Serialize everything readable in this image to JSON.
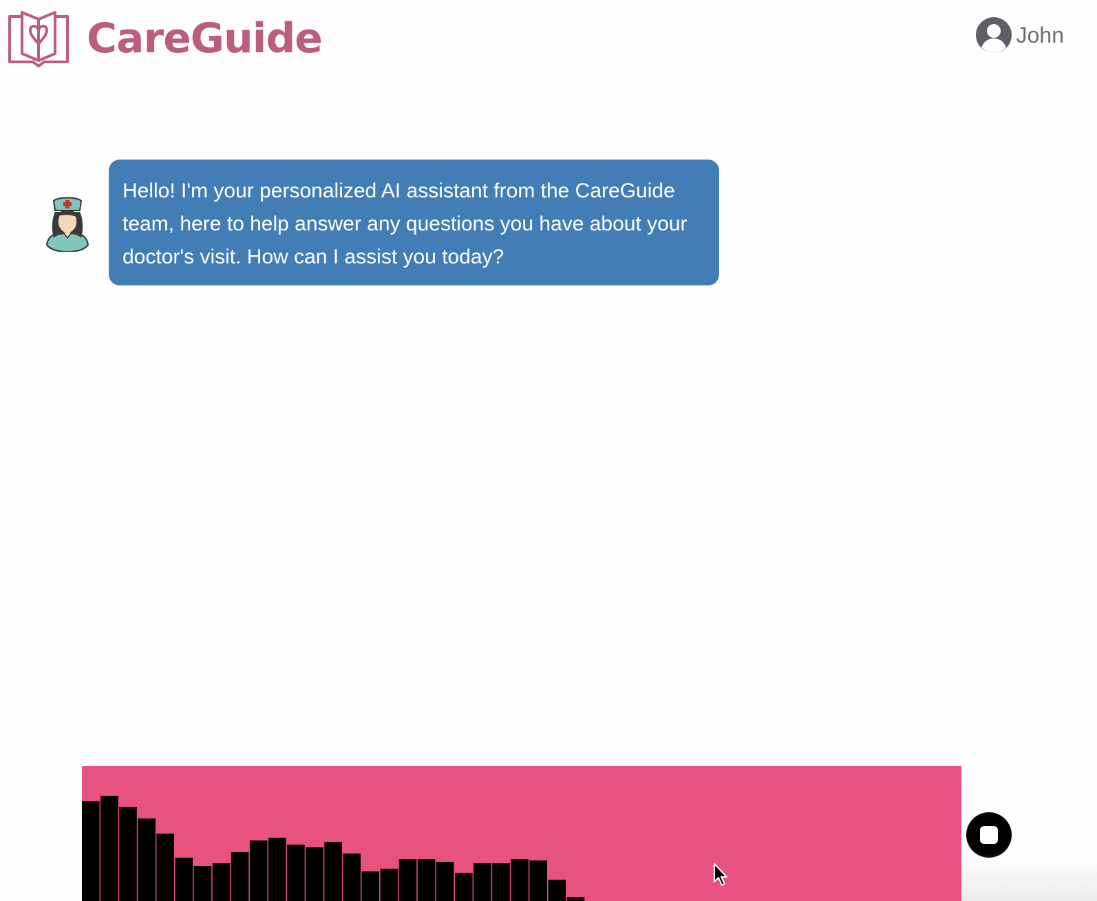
{
  "header": {
    "brand_name": "CareGuide",
    "brand_color": "#bb5d7c",
    "logo_icon": "heart-book-icon",
    "user": {
      "name": "John",
      "icon": "user-circle-icon"
    }
  },
  "chat": {
    "messages": [
      {
        "sender": "assistant",
        "avatar_icon": "nurse-avatar-icon",
        "text": "Hello! I'm your personalized AI assistant from the CareGuide team, here to help answer any questions you have about your doctor's visit. How can I assist you today?",
        "bubble_color": "#427db5"
      }
    ]
  },
  "recorder": {
    "background_color": "#e8527e",
    "bar_color": "#000000",
    "levels": [
      0.74,
      0.78,
      0.7,
      0.61,
      0.5,
      0.32,
      0.26,
      0.28,
      0.36,
      0.45,
      0.47,
      0.42,
      0.4,
      0.44,
      0.35,
      0.22,
      0.24,
      0.31,
      0.31,
      0.29,
      0.21,
      0.28,
      0.28,
      0.31,
      0.3,
      0.16,
      0.03
    ],
    "stop_icon": "stop-icon"
  }
}
